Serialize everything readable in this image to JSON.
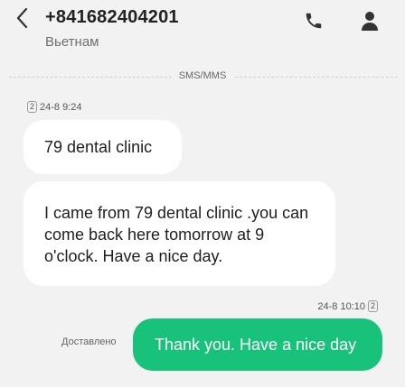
{
  "header": {
    "phone_number": "+841682404201",
    "location": "Вьетнам",
    "icons": {
      "back": "chevron-left-icon",
      "call": "phone-icon",
      "contact": "person-icon"
    }
  },
  "conversation": {
    "channel_label": "SMS/MMS",
    "incoming": {
      "sim": "2",
      "timestamp": "24-8 9:24",
      "messages": [
        "79 dental clinic",
        "I came from 79 dental clinic .you can come back here tomorrow at 9 o'clock. Have a nice day."
      ]
    },
    "outgoing": {
      "sim": "2",
      "timestamp": "24-8 10:10",
      "status": "Доставлено",
      "message": "Thank you. Have a nice day"
    }
  },
  "colors": {
    "background": "#f2f2f2",
    "incoming_bubble": "#ffffff",
    "outgoing_bubble": "#19c27a",
    "header_text": "#222222"
  }
}
